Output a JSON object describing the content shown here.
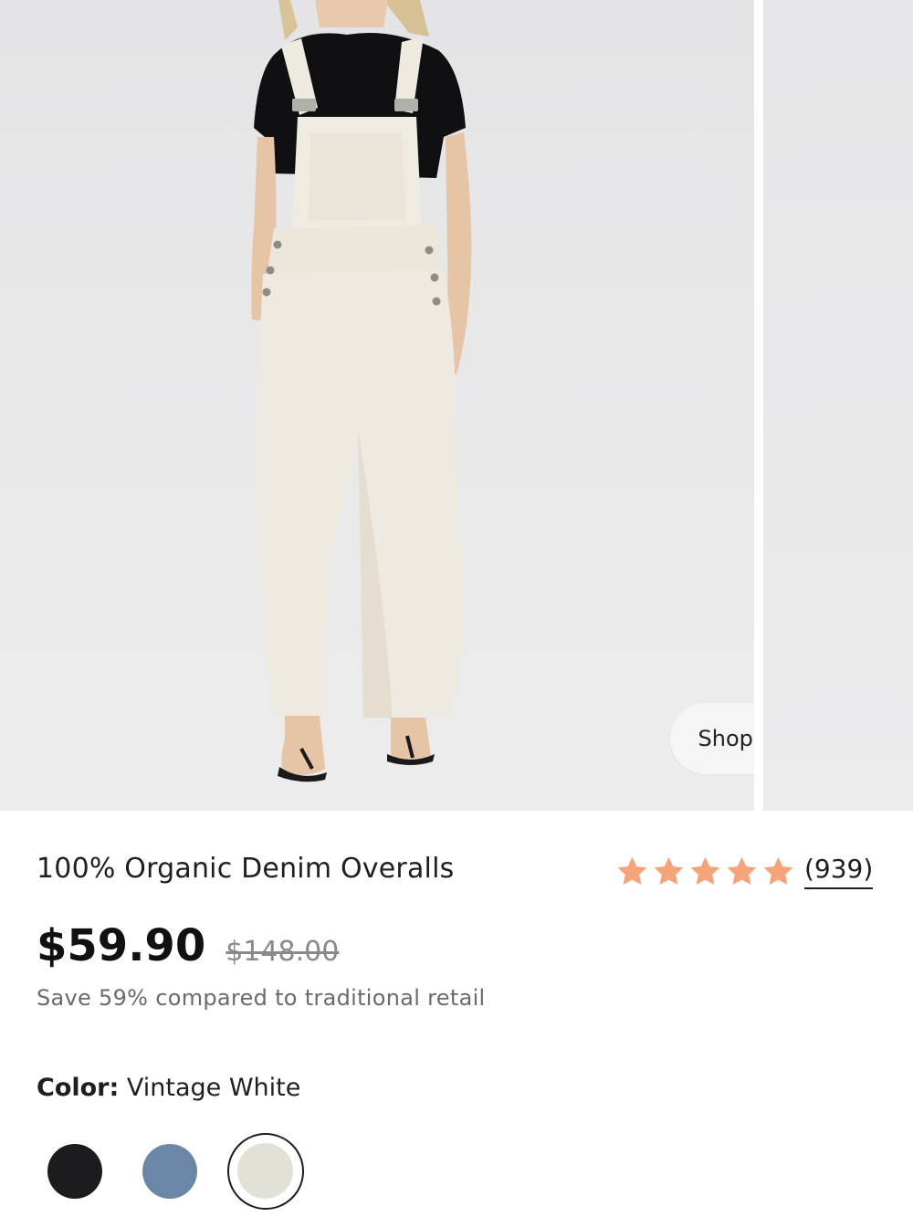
{
  "gallery": {
    "shop_the_look_label": "Shop the look"
  },
  "product": {
    "title": "100% Organic Denim Overalls",
    "rating": 5,
    "review_count": "(939)",
    "star_color": "#f4a37a",
    "price": "$59.90",
    "compare_price": "$148.00",
    "savings_text": "Save 59% compared to traditional retail"
  },
  "color_selector": {
    "label": "Color:",
    "selected_value": "Vintage White",
    "swatches": [
      {
        "name": "black",
        "hex": "#1c1c1e",
        "selected": false
      },
      {
        "name": "blue",
        "hex": "#6a88a6",
        "selected": false
      },
      {
        "name": "vintage-white",
        "hex": "#e3e0d5",
        "selected": true
      }
    ]
  }
}
